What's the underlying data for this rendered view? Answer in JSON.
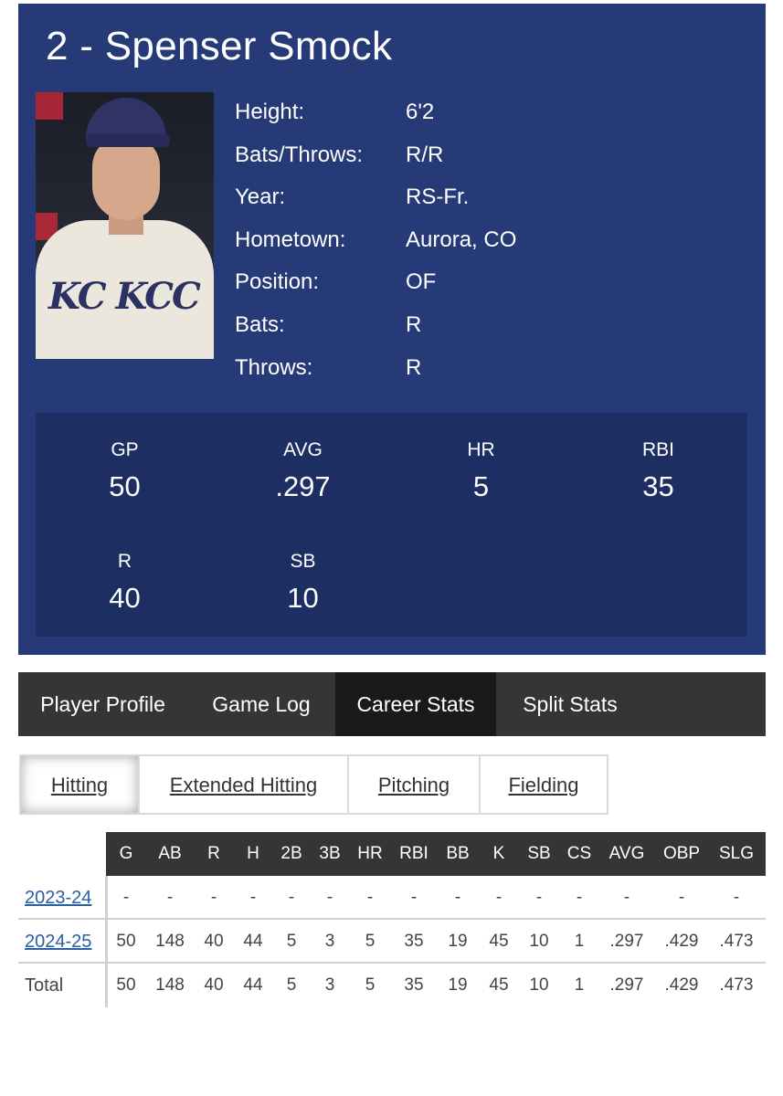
{
  "player": {
    "title": "2 - Spenser Smock",
    "photo_alt": "Spenser Smock",
    "bio": [
      {
        "label": "Height:",
        "value": "6'2"
      },
      {
        "label": "Bats/Throws:",
        "value": "R/R"
      },
      {
        "label": "Year:",
        "value": "RS-Fr."
      },
      {
        "label": "Hometown:",
        "value": "Aurora, CO"
      },
      {
        "label": "Position:",
        "value": "OF"
      },
      {
        "label": "Bats:",
        "value": "R"
      },
      {
        "label": "Throws:",
        "value": "R"
      }
    ],
    "summary": [
      {
        "label": "GP",
        "value": "50"
      },
      {
        "label": "AVG",
        "value": ".297"
      },
      {
        "label": "HR",
        "value": "5"
      },
      {
        "label": "RBI",
        "value": "35"
      },
      {
        "label": "R",
        "value": "40"
      },
      {
        "label": "SB",
        "value": "10"
      }
    ]
  },
  "tabs": [
    {
      "label": "Player Profile",
      "active": false
    },
    {
      "label": "Game Log",
      "active": false
    },
    {
      "label": "Career Stats",
      "active": true
    },
    {
      "label": "Split Stats",
      "active": false
    }
  ],
  "subtabs": [
    {
      "label": "Hitting",
      "active": true
    },
    {
      "label": "Extended Hitting",
      "active": false
    },
    {
      "label": "Pitching",
      "active": false
    },
    {
      "label": "Fielding",
      "active": false
    }
  ],
  "table": {
    "columns": [
      "G",
      "AB",
      "R",
      "H",
      "2B",
      "3B",
      "HR",
      "RBI",
      "BB",
      "K",
      "SB",
      "CS",
      "AVG",
      "OBP",
      "SLG"
    ],
    "rows": [
      {
        "label": "2023-24",
        "link": true,
        "cells": [
          "-",
          "-",
          "-",
          "-",
          "-",
          "-",
          "-",
          "-",
          "-",
          "-",
          "-",
          "-",
          "-",
          "-",
          "-"
        ]
      },
      {
        "label": "2024-25",
        "link": true,
        "cells": [
          "50",
          "148",
          "40",
          "44",
          "5",
          "3",
          "5",
          "35",
          "19",
          "45",
          "10",
          "1",
          ".297",
          ".429",
          ".473"
        ]
      },
      {
        "label": "Total",
        "link": false,
        "cells": [
          "50",
          "148",
          "40",
          "44",
          "5",
          "3",
          "5",
          "35",
          "19",
          "45",
          "10",
          "1",
          ".297",
          ".429",
          ".473"
        ]
      }
    ]
  },
  "colors": {
    "card": "#253a77",
    "stats_box": "#1d2e63",
    "tabbar": "#353535",
    "tab_active": "#1a1a1a",
    "link": "#2a5fa8"
  }
}
